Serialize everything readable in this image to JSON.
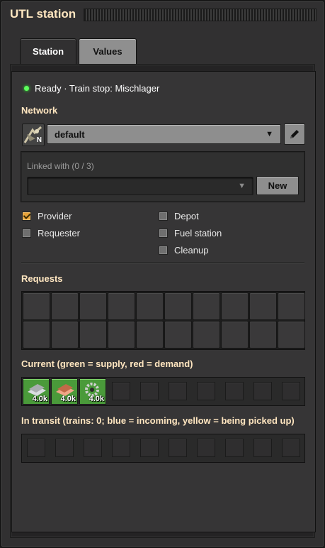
{
  "window": {
    "title": "UTL station"
  },
  "tabs": [
    {
      "label": "Station"
    },
    {
      "label": "Values"
    }
  ],
  "status": {
    "text": "Ready · Train stop: Mischlager",
    "color": "#5dff5d"
  },
  "network": {
    "section_label": "Network",
    "icon_letter": "N",
    "selected": "default",
    "linked_label": "Linked with (0 / 3)",
    "linked_selected": "",
    "new_button": "New"
  },
  "options": {
    "provider": {
      "label": "Provider",
      "checked": true
    },
    "requester": {
      "label": "Requester",
      "checked": false
    },
    "depot": {
      "label": "Depot",
      "checked": false
    },
    "fuel_station": {
      "label": "Fuel station",
      "checked": false
    },
    "cleanup": {
      "label": "Cleanup",
      "checked": false
    }
  },
  "requests": {
    "label": "Requests",
    "rows": 2,
    "cols": 10
  },
  "current": {
    "label": "Current (green = supply, red = demand)",
    "items": [
      {
        "icon": "iron-plate-icon",
        "amount": "4.0k",
        "color": "#4a9a3a"
      },
      {
        "icon": "copper-plate-icon",
        "amount": "4.0k",
        "color": "#4a9a3a"
      },
      {
        "icon": "gear-icon",
        "amount": "4.0k",
        "color": "#4a9a3a"
      }
    ]
  },
  "in_transit": {
    "label": "In transit (trains: 0; blue = incoming, yellow = being picked up)"
  },
  "colors": {
    "title": "#ffe6c0",
    "supply": "#4a9a3a",
    "checkbox_checked": "#e7a23a"
  }
}
